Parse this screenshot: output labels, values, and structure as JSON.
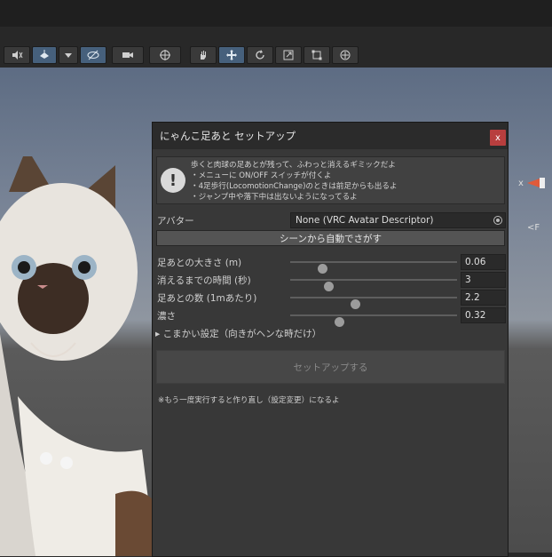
{
  "panel": {
    "title": "にゃんこ足あと セットアップ",
    "close_label": "x",
    "help_lines": [
      "歩くと肉球の足あとが残って、ふわっと消えるギミックだよ",
      "・メニューに ON/OFF スイッチが付くよ",
      "・4足歩行(LocomotionChange)のときは前足からも出るよ",
      "・ジャンプ中や落下中は出ないようになってるよ"
    ],
    "avatar_label": "アバター",
    "avatar_value": "None (VRC Avatar Descriptor)",
    "auto_find_label": "シーンから自動でさがす",
    "params": [
      {
        "label": "足あとの大きさ (m)",
        "value": "0.06",
        "fraction": 0.19
      },
      {
        "label": "消えるまでの時間 (秒)",
        "value": "3",
        "fraction": 0.23
      },
      {
        "label": "足あとの数 (1mあたり)",
        "value": "2.2",
        "fraction": 0.39
      },
      {
        "label": "濃さ",
        "value": "0.32",
        "fraction": 0.29
      }
    ],
    "foldout_label": "こまかい設定（向きがヘンな時だけ）",
    "setup_label": "セットアップする",
    "note": "※もう一度実行すると作り直し（設定変更）になるよ"
  },
  "gizmo": {
    "axis_label": "x",
    "persp_label": "<F"
  },
  "colors": {
    "accent": "#46607c",
    "close": "#b83e3e"
  }
}
